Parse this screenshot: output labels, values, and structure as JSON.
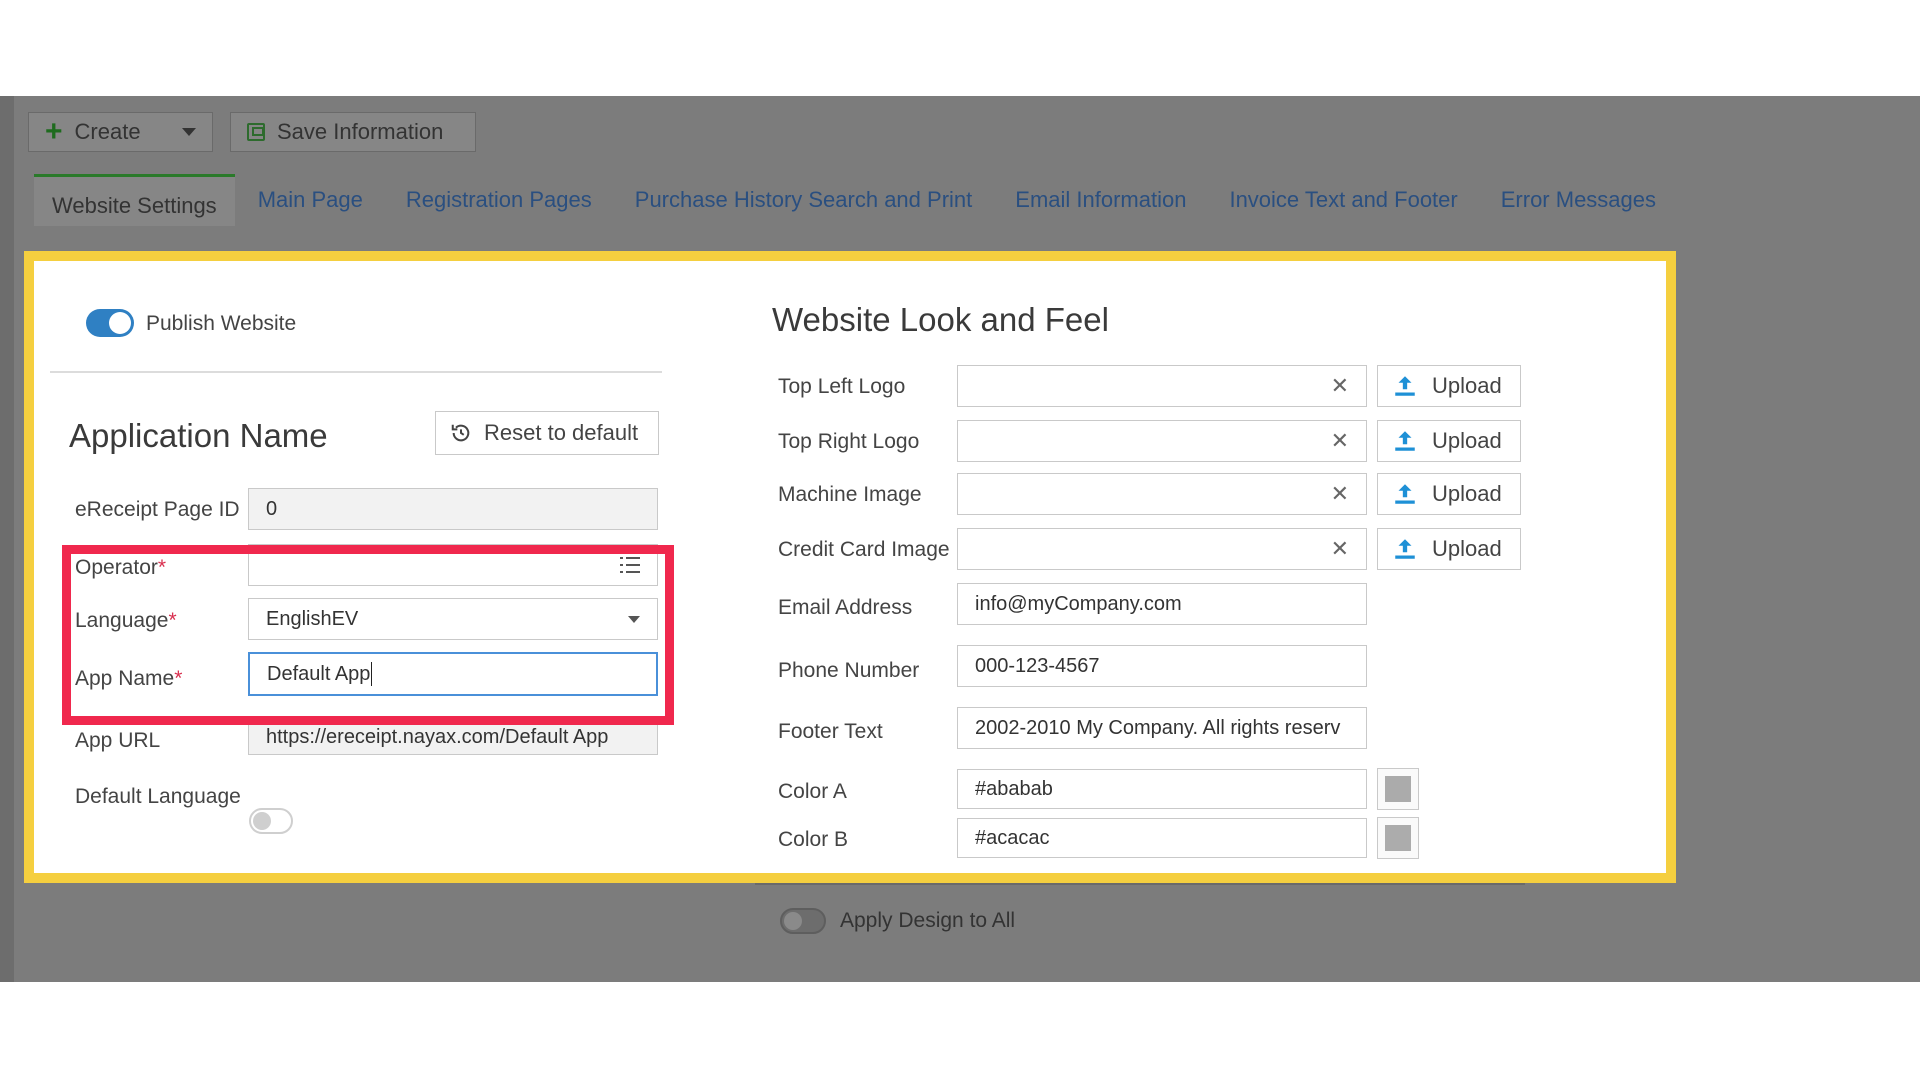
{
  "toolbar": {
    "create_label": "Create",
    "save_label": "Save Information"
  },
  "tabs": [
    {
      "label": "Website Settings",
      "active": true
    },
    {
      "label": "Main Page"
    },
    {
      "label": "Registration Pages"
    },
    {
      "label": "Purchase History Search and Print"
    },
    {
      "label": "Email Information"
    },
    {
      "label": "Invoice Text and Footer"
    },
    {
      "label": "Error Messages"
    }
  ],
  "left": {
    "publish_label": "Publish Website",
    "publish_on": true,
    "section_title": "Application Name",
    "reset_label": "Reset to default",
    "fields": {
      "page_id": {
        "label": "eReceipt Page ID",
        "value": "0"
      },
      "operator": {
        "label": "Operator",
        "required": "*",
        "value": ""
      },
      "language": {
        "label": "Language",
        "required": "*",
        "value": "EnglishEV"
      },
      "app_name": {
        "label": "App Name",
        "required": "*",
        "value": "Default App"
      },
      "app_url": {
        "label": "App URL",
        "value": "https://ereceipt.nayax.com/Default App"
      },
      "default_language": {
        "label": "Default Language",
        "on": false
      }
    }
  },
  "right": {
    "title": "Website Look and Feel",
    "upload_label": "Upload",
    "images": [
      {
        "label": "Top Left Logo",
        "value": ""
      },
      {
        "label": "Top Right Logo",
        "value": ""
      },
      {
        "label": "Machine Image",
        "value": ""
      },
      {
        "label": "Credit Card Image",
        "value": ""
      }
    ],
    "email": {
      "label": "Email Address",
      "value": "info@myCompany.com"
    },
    "phone": {
      "label": "Phone Number",
      "value": "000-123-4567"
    },
    "footer": {
      "label": "Footer Text",
      "value": "2002-2010 My Company. All rights reserv"
    },
    "color_a": {
      "label": "Color A",
      "value": "#ababab"
    },
    "color_b": {
      "label": "Color B",
      "value": "#acacac"
    }
  },
  "apply_design": {
    "label": "Apply Design to All",
    "on": false
  },
  "colors": {
    "highlight_yellow": "#f5cf3f",
    "highlight_red": "#f0284d",
    "toggle_on": "#2f80c3",
    "upload_icon": "#1e90d6"
  }
}
